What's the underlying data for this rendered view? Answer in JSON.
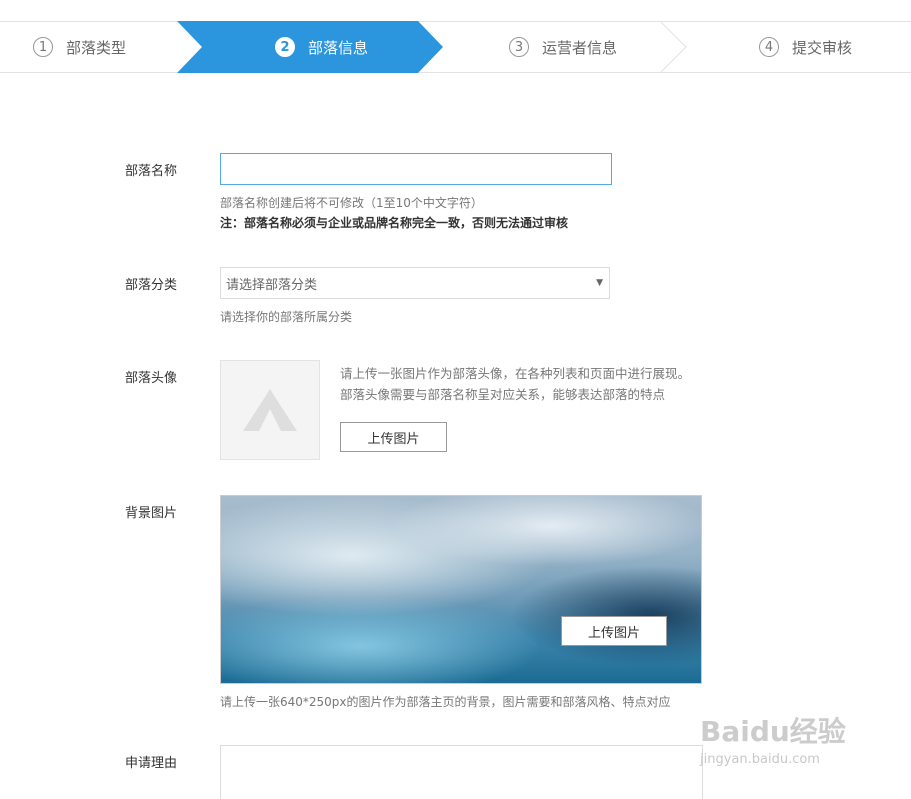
{
  "steps": [
    {
      "num": "1",
      "label": "部落类型",
      "active": false
    },
    {
      "num": "2",
      "label": "部落信息",
      "active": true
    },
    {
      "num": "3",
      "label": "运营者信息",
      "active": false
    },
    {
      "num": "4",
      "label": "提交审核",
      "active": false
    }
  ],
  "colors": {
    "accent": "#2b95dd",
    "input_focus": "#53a9e6"
  },
  "form": {
    "name": {
      "label": "部落名称",
      "value": "",
      "hint": "部落名称创建后将不可修改（1至10个中文字符）",
      "note": "注：部落名称必须与企业或品牌名称完全一致，否则无法通过审核"
    },
    "category": {
      "label": "部落分类",
      "placeholder": "请选择部落分类",
      "hint": "请选择你的部落所属分类"
    },
    "avatar": {
      "label": "部落头像",
      "desc_line1": "请上传一张图片作为部落头像，在各种列表和页面中进行展现。",
      "desc_line2": "部落头像需要与部落名称呈对应关系，能够表达部落的特点",
      "upload_label": "上传图片"
    },
    "background": {
      "label": "背景图片",
      "upload_label": "上传图片",
      "hint": "请上传一张640*250px的图片作为部落主页的背景，图片需要和部落风格、特点对应"
    },
    "reason": {
      "label": "申请理由",
      "value": ""
    }
  },
  "watermark": {
    "brand": "Baidu经验",
    "url": "jingyan.baidu.com"
  }
}
